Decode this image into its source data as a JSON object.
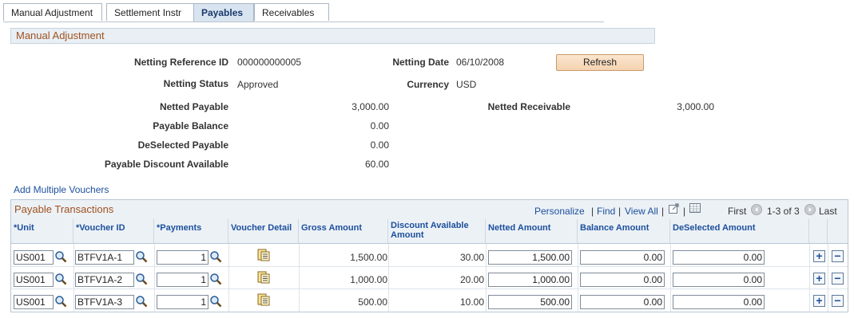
{
  "tabs": [
    {
      "label": "Manual Adjustment",
      "active": false
    },
    {
      "label": "Settlement Instr",
      "active": false
    },
    {
      "label": "Payables",
      "active": true
    },
    {
      "label": "Receivables",
      "active": false
    }
  ],
  "section_title": "Manual Adjustment",
  "header": {
    "netting_reference_id_label": "Netting Reference ID",
    "netting_reference_id": "000000000005",
    "netting_date_label": "Netting Date",
    "netting_date": "06/10/2008",
    "refresh_label": "Refresh",
    "netting_status_label": "Netting Status",
    "netting_status": "Approved",
    "currency_label": "Currency",
    "currency": "USD",
    "netted_payable_label": "Netted Payable",
    "netted_payable": "3,000.00",
    "netted_receivable_label": "Netted Receivable",
    "netted_receivable": "3,000.00",
    "payable_balance_label": "Payable Balance",
    "payable_balance": "0.00",
    "deselected_payable_label": "DeSelected Payable",
    "deselected_payable": "0.00",
    "payable_discount_label": "Payable Discount Available",
    "payable_discount": "60.00"
  },
  "add_multiple_vouchers": "Add Multiple Vouchers",
  "grid": {
    "title": "Payable Transactions",
    "personalize": "Personalize",
    "find": "Find",
    "view_all": "View All",
    "first": "First",
    "range": "1-3 of 3",
    "last": "Last",
    "columns": [
      "*Unit",
      "*Voucher ID",
      "*Payments",
      "Voucher Detail",
      "Gross Amount",
      "Discount Available Amount",
      "Netted Amount",
      "Balance Amount",
      "DeSelected Amount"
    ],
    "rows": [
      {
        "unit": "US001",
        "voucher_id": "BTFV1A-1",
        "payments": "1",
        "gross": "1,500.00",
        "discount": "30.00",
        "netted": "1,500.00",
        "balance": "0.00",
        "deselected": "0.00"
      },
      {
        "unit": "US001",
        "voucher_id": "BTFV1A-2",
        "payments": "1",
        "gross": "1,000.00",
        "discount": "20.00",
        "netted": "1,000.00",
        "balance": "0.00",
        "deselected": "0.00"
      },
      {
        "unit": "US001",
        "voucher_id": "BTFV1A-3",
        "payments": "1",
        "gross": "500.00",
        "discount": "10.00",
        "netted": "500.00",
        "balance": "0.00",
        "deselected": "0.00"
      }
    ]
  }
}
